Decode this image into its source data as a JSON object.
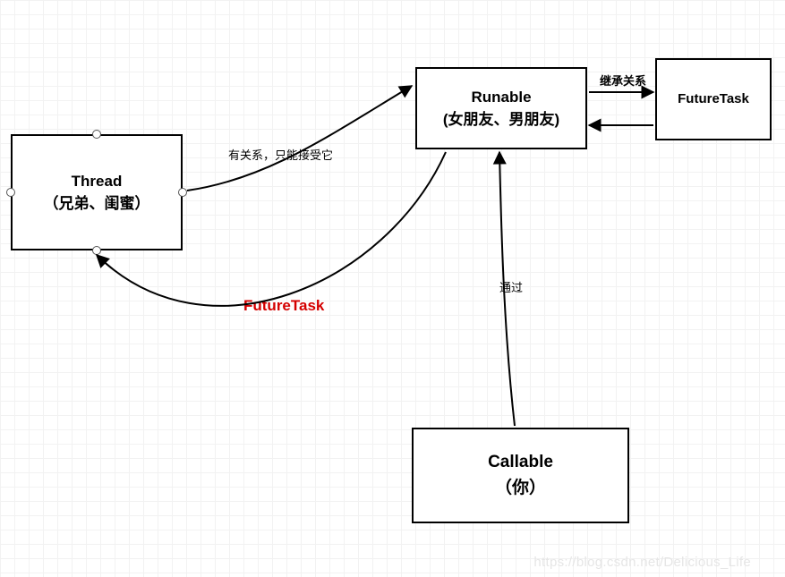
{
  "boxes": {
    "thread": {
      "line1": "Thread",
      "line2": "（兄弟、闺蜜）"
    },
    "runnable": {
      "line1": "Runable",
      "line2": "(女朋友、男朋友)"
    },
    "futuretask_box": {
      "line1": "FutureTask"
    },
    "callable": {
      "line1": "Callable",
      "line2": "（你）"
    }
  },
  "labels": {
    "relation": "有关系，只能接受它",
    "futuretask": "FutureTask",
    "via": "通过",
    "inherit": "继承关系"
  },
  "watermark": "https://blog.csdn.net/Delicious_Life"
}
